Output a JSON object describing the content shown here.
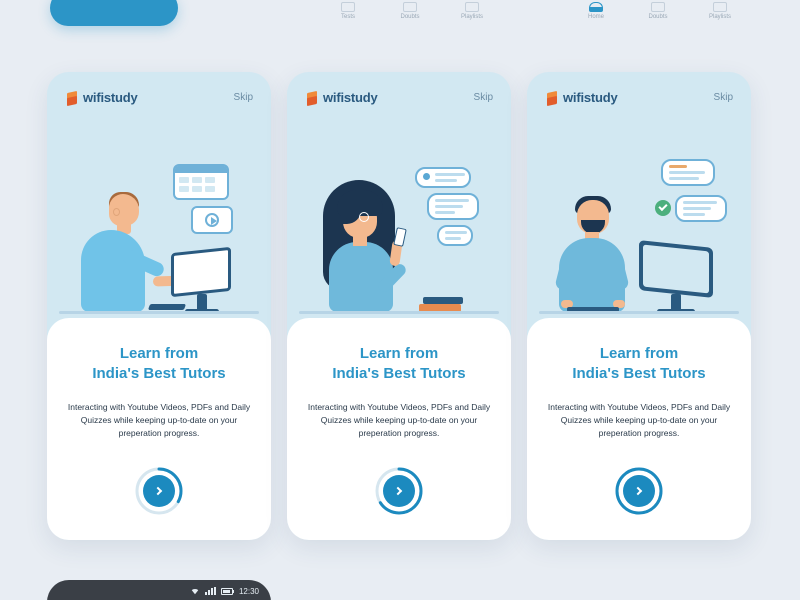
{
  "brand": "wifistudy",
  "skip": "Skip",
  "nav": {
    "tests": "Tests",
    "home": "Home",
    "doubts": "Doubts",
    "playlists": "Playlists"
  },
  "onboard": {
    "title_l1": "Learn from",
    "title_l2": "India's Best Tutors",
    "desc": "Interacting with Youtube Videos, PDFs and Daily Quizzes while keeping up-to-date on your preperation progress."
  },
  "progress": {
    "card1": 0.33,
    "card2": 0.66,
    "card3": 1.0
  },
  "statusbar": {
    "time": "12:30"
  }
}
